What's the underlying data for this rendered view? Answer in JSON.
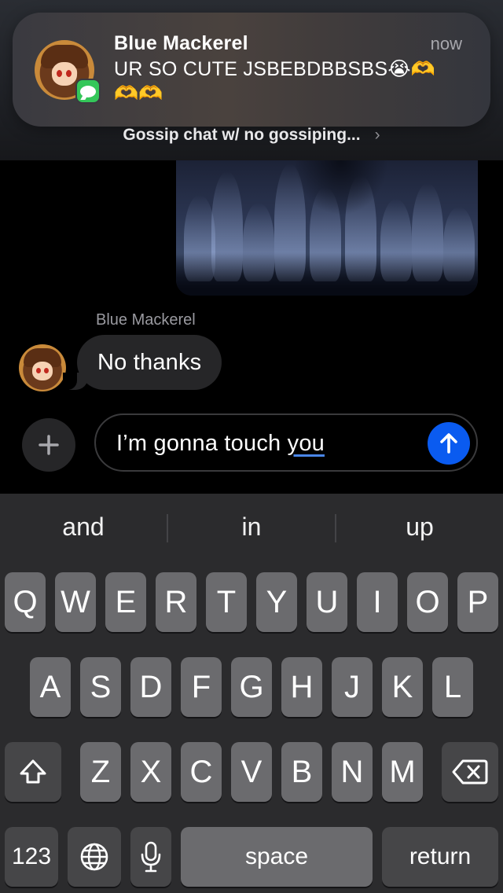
{
  "notification": {
    "sender": "Blue Mackerel",
    "time": "now",
    "message": "UR SO CUTE JSBEBDBBSBS😭🫶🫶🫶",
    "group": "Gossip chat w/ no gossiping...",
    "group_chevron": "›",
    "app_icon": "messages-icon"
  },
  "conversation": {
    "sender_name": "Blue Mackerel",
    "incoming_message": "No thanks"
  },
  "compose": {
    "text_before": "I’m gonna touch ",
    "text_underlined": "you",
    "send_icon": "arrow-up-icon",
    "plus_icon": "plus-icon"
  },
  "keyboard": {
    "suggestions": [
      "and",
      "in",
      "up"
    ],
    "row1": [
      "Q",
      "W",
      "E",
      "R",
      "T",
      "Y",
      "U",
      "I",
      "O",
      "P"
    ],
    "row2": [
      "A",
      "S",
      "D",
      "F",
      "G",
      "H",
      "J",
      "K",
      "L"
    ],
    "row3": [
      "Z",
      "X",
      "C",
      "V",
      "B",
      "N",
      "M"
    ],
    "numbers_label": "123",
    "space_label": "space",
    "return_label": "return",
    "shift_icon": "shift-icon",
    "delete_icon": "delete-icon",
    "globe_icon": "globe-icon",
    "mic_icon": "microphone-icon"
  }
}
